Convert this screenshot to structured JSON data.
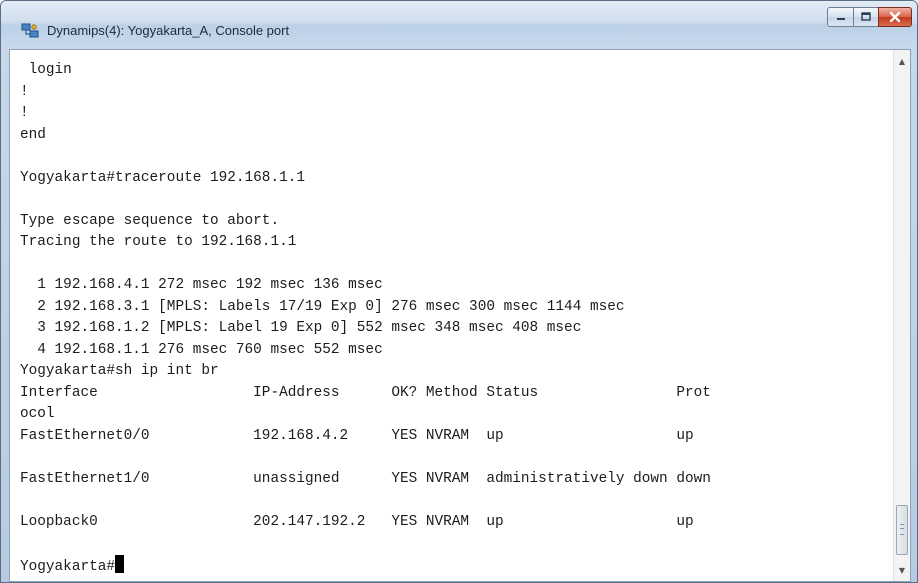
{
  "window": {
    "title": "Dynamips(4): Yogyakarta_A, Console port",
    "icon": "network-port-icon",
    "controls": {
      "minimize": "minimize-icon",
      "maximize": "maximize-icon",
      "close": "close-icon"
    }
  },
  "console": {
    "lines": [
      " login",
      "!",
      "!",
      "end",
      "",
      "Yogyakarta#traceroute 192.168.1.1",
      "",
      "Type escape sequence to abort.",
      "Tracing the route to 192.168.1.1",
      "",
      "  1 192.168.4.1 272 msec 192 msec 136 msec",
      "  2 192.168.3.1 [MPLS: Labels 17/19 Exp 0] 276 msec 300 msec 1144 msec",
      "  3 192.168.1.2 [MPLS: Label 19 Exp 0] 552 msec 348 msec 408 msec",
      "  4 192.168.1.1 276 msec 760 msec 552 msec",
      "Yogyakarta#sh ip int br",
      "Interface                  IP-Address      OK? Method Status                Prot",
      "ocol",
      "FastEthernet0/0            192.168.4.2     YES NVRAM  up                    up",
      "",
      "FastEthernet1/0            unassigned      YES NVRAM  administratively down down",
      "",
      "Loopback0                  202.147.192.2   YES NVRAM  up                    up",
      ""
    ],
    "prompt": "Yogyakarta#"
  },
  "colors": {
    "titlebar": "#c6d8ec",
    "close_button": "#c23a1f",
    "console_background": "#ffffff",
    "console_text": "#1c1c1c"
  }
}
